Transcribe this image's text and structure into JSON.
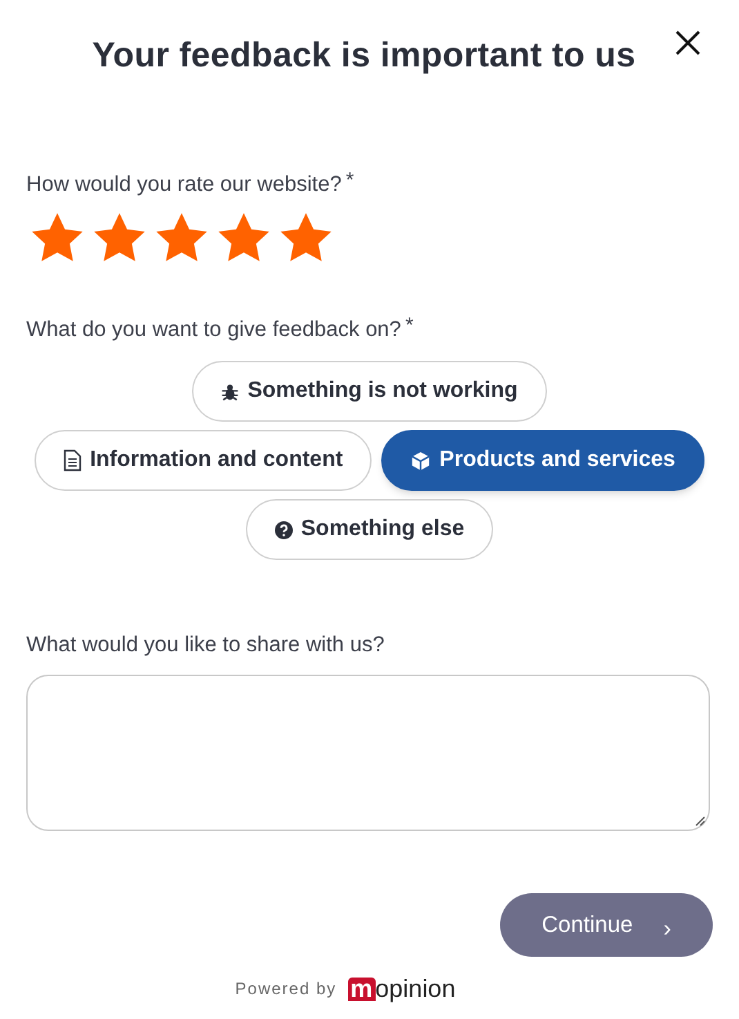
{
  "title": "Your feedback is important to us",
  "rating": {
    "label": "How would you rate our website?",
    "required_mark": "*",
    "stars": 5
  },
  "topic": {
    "label": "What do you want to give feedback on?",
    "required_mark": "*",
    "option_rows": [
      [
        {
          "kind": "bug",
          "label": "Something is not working",
          "selected": false
        }
      ],
      [
        {
          "kind": "document",
          "label": "Information and content",
          "selected": false
        },
        {
          "kind": "box",
          "label": "Products and services",
          "selected": true
        }
      ],
      [
        {
          "kind": "question",
          "label": "Something else",
          "selected": false
        }
      ]
    ]
  },
  "comment": {
    "label": "What would you like to share with us?"
  },
  "continue_button": {
    "label": "Continue",
    "arrow": "›"
  },
  "footer": {
    "powered_by": "Powered by",
    "logo_mark": "m",
    "logo_text": "opinion"
  }
}
